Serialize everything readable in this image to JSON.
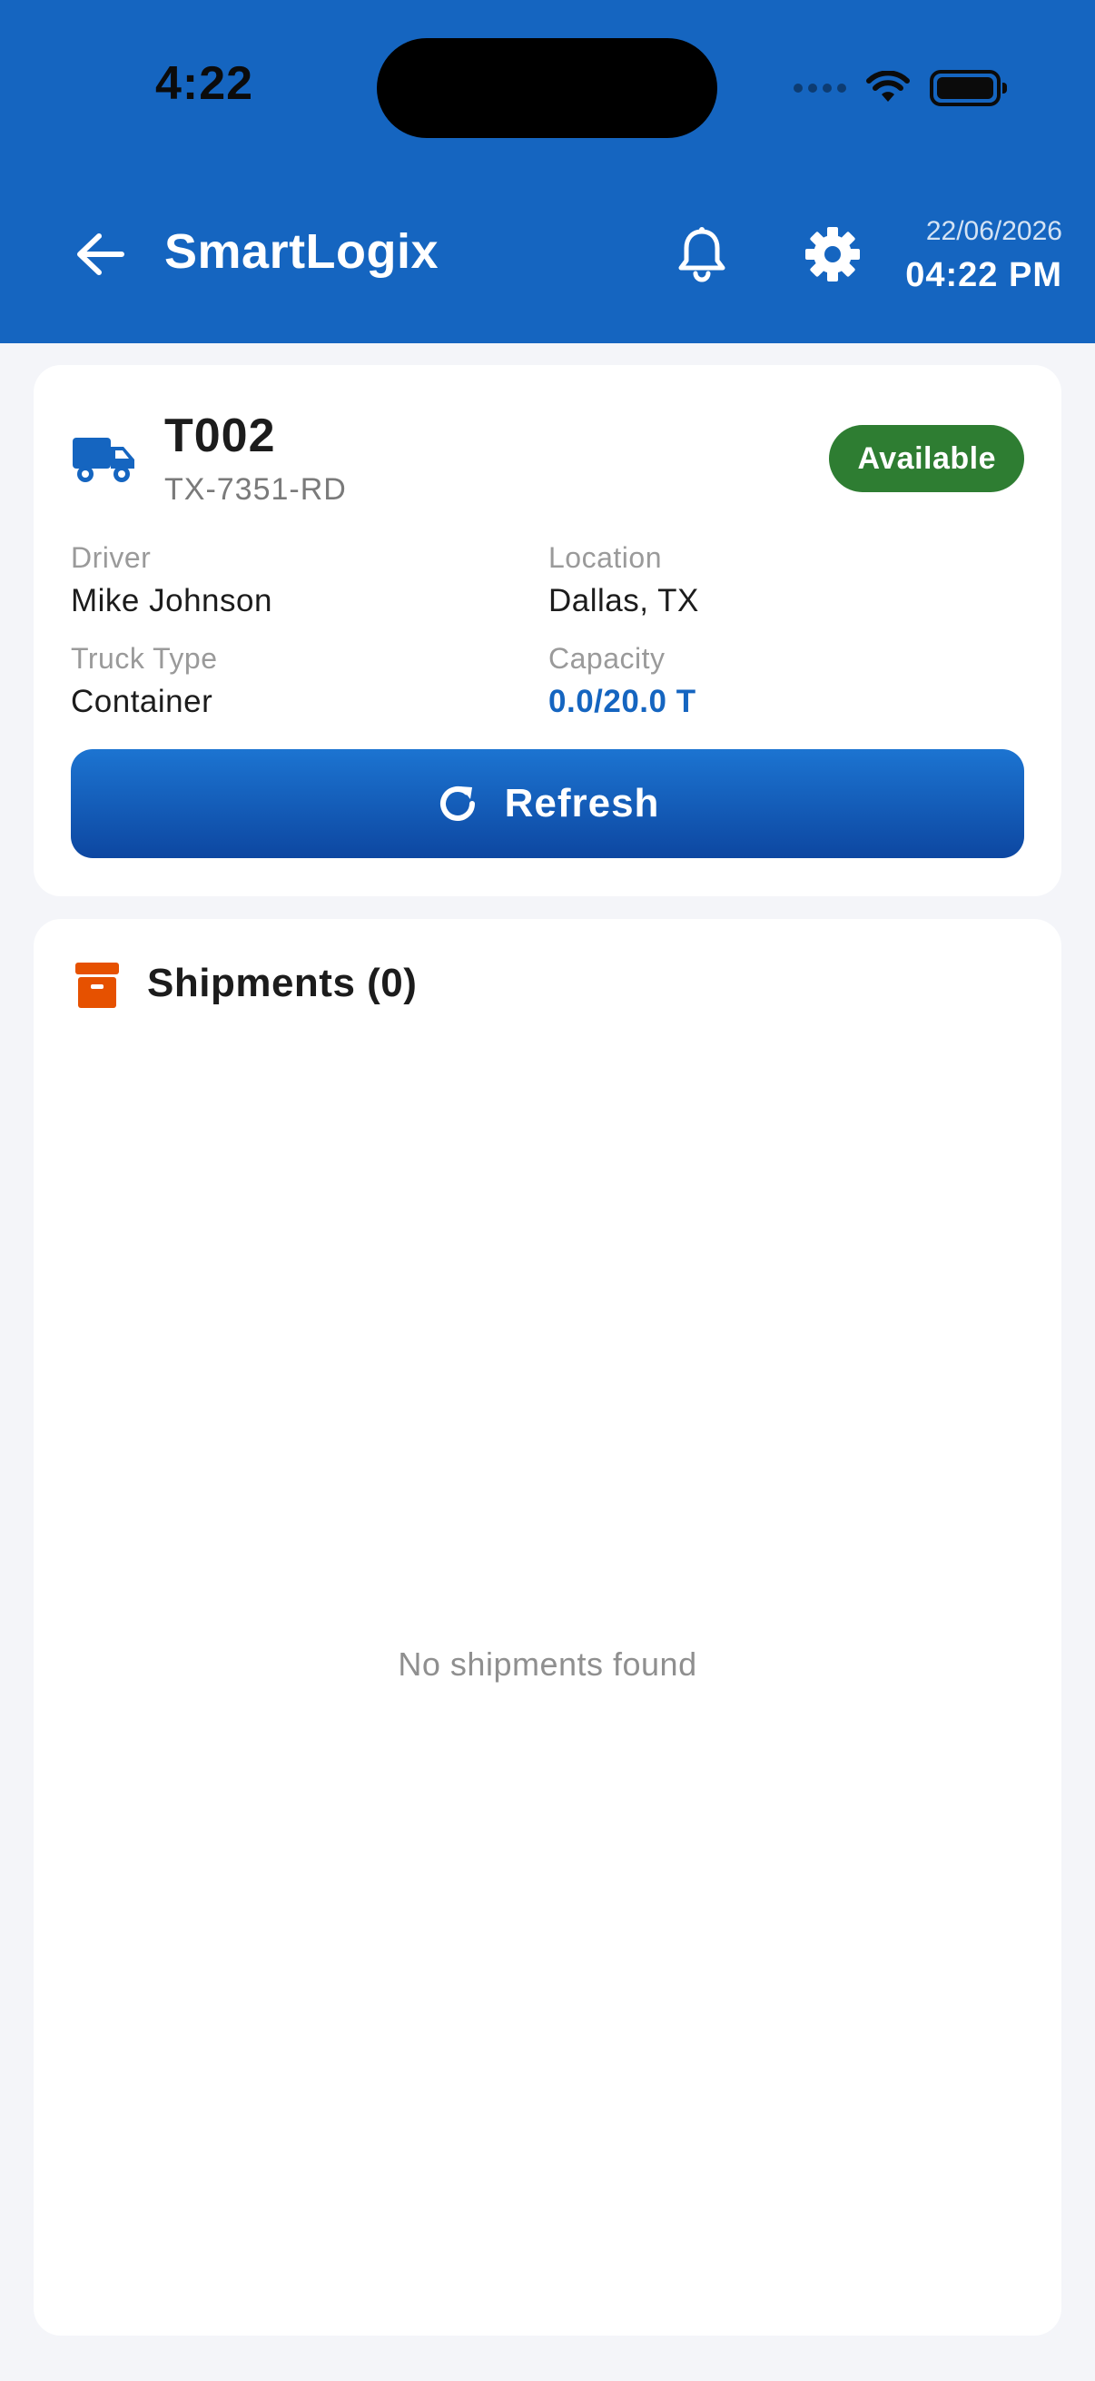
{
  "status_bar": {
    "time": "4:22"
  },
  "header": {
    "title": "SmartLogix",
    "date": "22/06/2026",
    "time": "04:22 PM"
  },
  "icons": {
    "back": "arrow-left-icon",
    "notifications": "bell-icon",
    "settings": "gear-icon",
    "truck": "truck-icon",
    "refresh": "refresh-icon",
    "shipments": "archive-box-icon"
  },
  "truck": {
    "id": "T002",
    "plate": "TX-7351-RD",
    "status": "Available",
    "fields": {
      "driver_label": "Driver",
      "driver_value": "Mike Johnson",
      "location_label": "Location",
      "location_value": "Dallas, TX",
      "type_label": "Truck Type",
      "type_value": "Container",
      "capacity_label": "Capacity",
      "capacity_value": "0.0/20.0 T"
    },
    "refresh_label": "Refresh"
  },
  "shipments": {
    "title": "Shipments (0)",
    "empty_message": "No shipments found"
  },
  "colors": {
    "primary": "#1565c0",
    "status_available": "#2e7d32",
    "shipments_icon": "#e65100",
    "background": "#f4f5f9"
  }
}
